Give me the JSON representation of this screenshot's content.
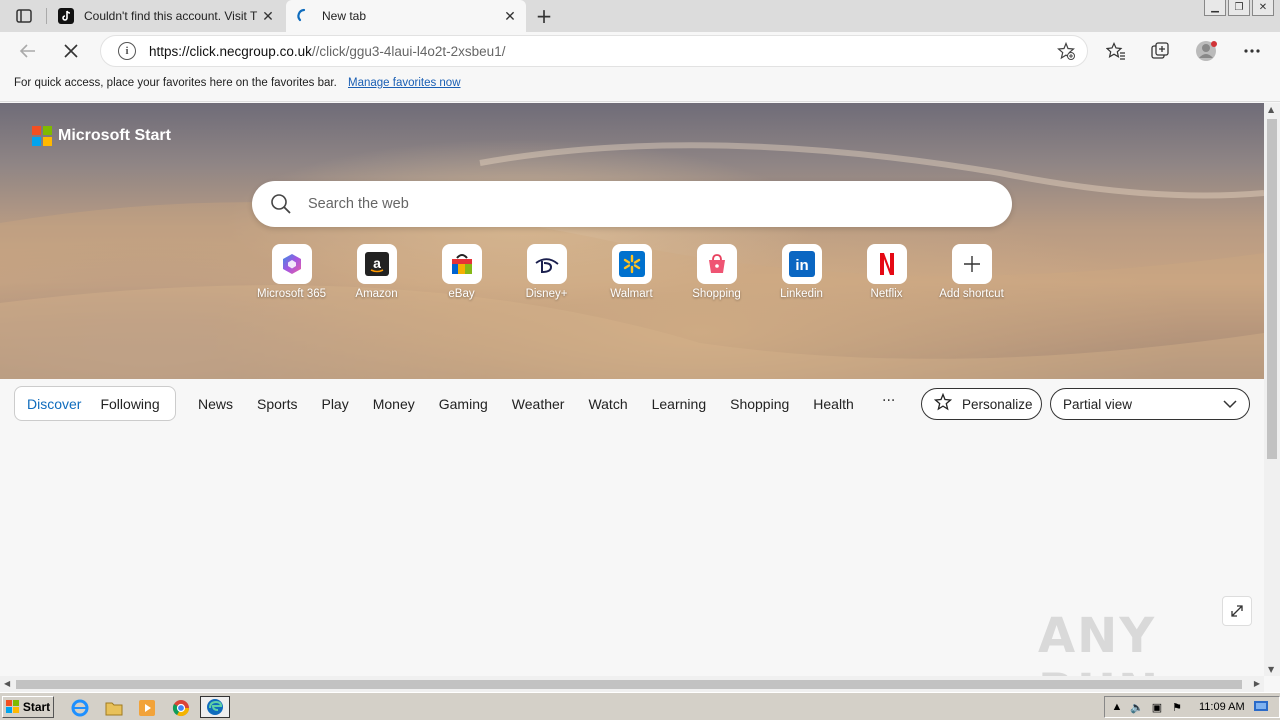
{
  "tabs": [
    {
      "title": "Couldn't find this account. Visit T",
      "favicon": "tiktok-icon",
      "close": "✕"
    },
    {
      "title": "New tab",
      "favicon": "edge-loading-icon",
      "close": "✕"
    }
  ],
  "new_tab": "+",
  "address": {
    "url_host": "https://click.necgroup.co.uk",
    "url_path": "//click/ggu3-4laui-l4o2t-2xsbeu1/"
  },
  "favorites_bar": {
    "message": "For quick access, place your favorites here on the favorites bar.",
    "link": "Manage favorites now"
  },
  "brand": {
    "name": "Microsoft Start"
  },
  "search": {
    "placeholder": "Search the web"
  },
  "shortcuts": [
    {
      "label": "Microsoft 365",
      "icon": "microsoft365-icon"
    },
    {
      "label": "Amazon",
      "icon": "amazon-icon"
    },
    {
      "label": "eBay",
      "icon": "ebay-icon"
    },
    {
      "label": "Disney+",
      "icon": "disney-icon"
    },
    {
      "label": "Walmart",
      "icon": "walmart-icon"
    },
    {
      "label": "Shopping",
      "icon": "shopping-bag-icon"
    },
    {
      "label": "Linkedin",
      "icon": "linkedin-icon"
    },
    {
      "label": "Netflix",
      "icon": "netflix-icon"
    },
    {
      "label": "Add shortcut",
      "icon": "plus-icon"
    }
  ],
  "feed_nav": {
    "discover": "Discover",
    "following": "Following",
    "categories": [
      "News",
      "Sports",
      "Play",
      "Money",
      "Gaming",
      "Weather",
      "Watch",
      "Learning",
      "Shopping",
      "Health"
    ],
    "more": "···",
    "personalize": "Personalize",
    "view_select": "Partial view"
  },
  "watermark": "ANY RUN",
  "taskbar": {
    "start": "Start",
    "time": "11:09 AM"
  },
  "colors": {
    "accent": "#0f6cbd",
    "link": "#1a5fb4"
  }
}
